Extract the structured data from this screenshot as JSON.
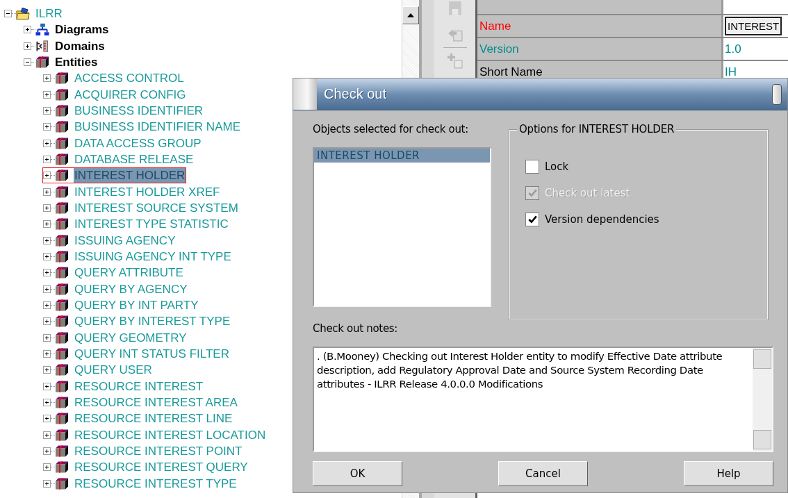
{
  "tree": [
    {
      "label": "ILRR",
      "kind": "model",
      "expanded": true,
      "selected": false,
      "children": [
        {
          "label": "Diagrams",
          "kind": "diagrams",
          "expanded": false,
          "selected": false
        },
        {
          "label": "Domains",
          "kind": "domains",
          "expanded": false,
          "selected": false
        },
        {
          "label": "Entities",
          "kind": "entities",
          "expanded": true,
          "selected": false,
          "children": [
            {
              "label": "ACCESS CONTROL",
              "kind": "entity",
              "expanded": false,
              "selected": false
            },
            {
              "label": "ACQUIRER CONFIG",
              "kind": "entity",
              "expanded": false,
              "selected": false
            },
            {
              "label": "BUSINESS IDENTIFIER",
              "kind": "entity",
              "expanded": false,
              "selected": false
            },
            {
              "label": "BUSINESS IDENTIFIER NAME",
              "kind": "entity",
              "expanded": false,
              "selected": false
            },
            {
              "label": "DATA ACCESS GROUP",
              "kind": "entity",
              "expanded": false,
              "selected": false
            },
            {
              "label": "DATABASE RELEASE",
              "kind": "entity",
              "expanded": false,
              "selected": false
            },
            {
              "label": "INTEREST HOLDER",
              "kind": "entity",
              "expanded": false,
              "selected": true
            },
            {
              "label": "INTEREST HOLDER XREF",
              "kind": "entity",
              "expanded": false,
              "selected": false
            },
            {
              "label": "INTEREST SOURCE SYSTEM",
              "kind": "entity",
              "expanded": false,
              "selected": false
            },
            {
              "label": "INTEREST TYPE STATISTIC",
              "kind": "entity",
              "expanded": false,
              "selected": false
            },
            {
              "label": "ISSUING AGENCY",
              "kind": "entity",
              "expanded": false,
              "selected": false
            },
            {
              "label": "ISSUING AGENCY INT TYPE",
              "kind": "entity",
              "expanded": false,
              "selected": false
            },
            {
              "label": "QUERY ATTRIBUTE",
              "kind": "entity",
              "expanded": false,
              "selected": false
            },
            {
              "label": "QUERY BY AGENCY",
              "kind": "entity",
              "expanded": false,
              "selected": false
            },
            {
              "label": "QUERY BY INT PARTY",
              "kind": "entity",
              "expanded": false,
              "selected": false
            },
            {
              "label": "QUERY BY INTEREST TYPE",
              "kind": "entity",
              "expanded": false,
              "selected": false
            },
            {
              "label": "QUERY GEOMETRY",
              "kind": "entity",
              "expanded": false,
              "selected": false
            },
            {
              "label": "QUERY INT STATUS FILTER",
              "kind": "entity",
              "expanded": false,
              "selected": false
            },
            {
              "label": "QUERY USER",
              "kind": "entity",
              "expanded": false,
              "selected": false
            },
            {
              "label": "RESOURCE INTEREST",
              "kind": "entity",
              "expanded": false,
              "selected": false
            },
            {
              "label": "RESOURCE INTEREST AREA",
              "kind": "entity",
              "expanded": false,
              "selected": false
            },
            {
              "label": "RESOURCE INTEREST LINE",
              "kind": "entity",
              "expanded": false,
              "selected": false
            },
            {
              "label": "RESOURCE INTEREST LOCATION",
              "kind": "entity",
              "expanded": false,
              "selected": false
            },
            {
              "label": "RESOURCE INTEREST POINT",
              "kind": "entity",
              "expanded": false,
              "selected": false
            },
            {
              "label": "RESOURCE INTEREST QUERY",
              "kind": "entity",
              "expanded": false,
              "selected": false
            },
            {
              "label": "RESOURCE INTEREST TYPE",
              "kind": "entity",
              "expanded": false,
              "selected": false
            }
          ]
        }
      ]
    }
  ],
  "properties": [
    {
      "label": "Name",
      "value": "INTEREST",
      "color": "#ff0000",
      "editing": true
    },
    {
      "label": "Version",
      "value": "1.0",
      "color": "#008c8c",
      "editing": false
    },
    {
      "label": "Short Name",
      "value": "IH",
      "color": "#000000",
      "editing": false
    }
  ],
  "dialog": {
    "title": "Check out",
    "objects_label": "Objects selected for check out:",
    "objects": [
      {
        "label": "INTEREST HOLDER",
        "selected": true
      }
    ],
    "options_title": "Options for INTEREST HOLDER",
    "options": [
      {
        "label": "Lock",
        "checked": false,
        "disabled": false
      },
      {
        "label": "Check out latest",
        "checked": true,
        "disabled": true
      },
      {
        "label": "Version dependencies",
        "checked": true,
        "disabled": false
      }
    ],
    "notes_label": "Check out notes:",
    "notes": ". (B.Mooney) Checking out Interest Holder entity to modify Effective Date attribute description, add Regulatory Approval Date and Source System Recording Date attributes - ILRR Release 4.0.0.0 Modifications",
    "buttons": [
      "OK",
      "Cancel",
      "Help"
    ]
  }
}
